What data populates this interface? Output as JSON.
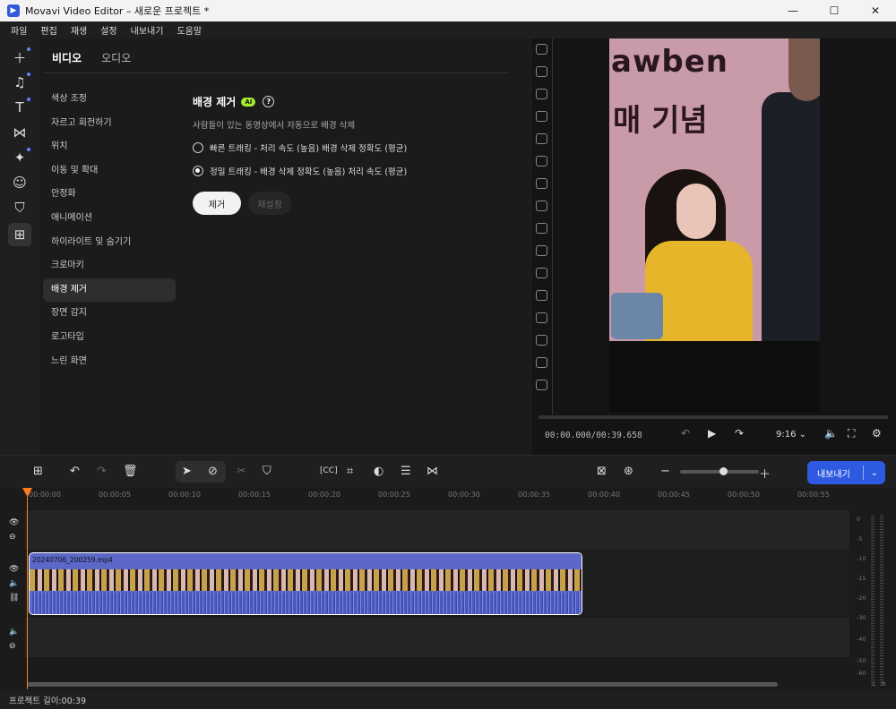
{
  "window": {
    "title": "Movavi Video Editor – 새로운 프로젝트 *",
    "minimize": "—",
    "maximize": "☐",
    "close": "✕"
  },
  "menu": [
    "파일",
    "편집",
    "재생",
    "설정",
    "내보내기",
    "도움말"
  ],
  "tabs": {
    "video": "비디오",
    "audio": "오디오"
  },
  "filters": [
    "색상 조정",
    "자르고 회전하기",
    "위치",
    "이동 및 확대",
    "안정화",
    "애니메이션",
    "하이라이트 및 숨기기",
    "크로마키",
    "배경 제거",
    "장면 감지",
    "로고타입",
    "느린 화면"
  ],
  "active_filter_index": 8,
  "bg_removal": {
    "title": "배경 제거",
    "ai_badge": "AI",
    "help": "?",
    "description": "사람들이 있는 동영상에서 자동으로 배경 삭제",
    "option_fast": "빠른 트래킹 - 처리 속도 (높음)  배경 삭제 정확도 (평균)",
    "option_precise": "정밀 트래킹 - 배경 삭제 정확도 (높음)  처리 속도 (평균)",
    "selected_option": "precise",
    "remove_button": "제거",
    "reset_button": "재설정"
  },
  "preview": {
    "sign_line1": "awben",
    "sign_line2": "매 기념 ",
    "timecode": "00:00.000/00:39.658",
    "aspect": "9:16"
  },
  "export_button": "내보내기",
  "ruler": [
    "00:00:00",
    "00:00:05",
    "00:00:10",
    "00:00:15",
    "00:00:20",
    "00:00:25",
    "00:00:30",
    "00:00:35",
    "00:00:40",
    "00:00:45",
    "00:00:50",
    "00:00:55"
  ],
  "clip": {
    "name": "20240706_200259.mp4"
  },
  "meter_labels": [
    "0",
    "-5",
    "-10",
    "-15",
    "-20",
    "-30",
    "-40",
    "-50",
    "-60"
  ],
  "meter_channels": [
    "L",
    "R"
  ],
  "status": "프로젝트 길이:00:39",
  "colors": {
    "accent": "#2d5ae0",
    "ai_badge": "#a7f02f",
    "playhead": "#ff7a1a",
    "clip": "#5c67c8"
  }
}
